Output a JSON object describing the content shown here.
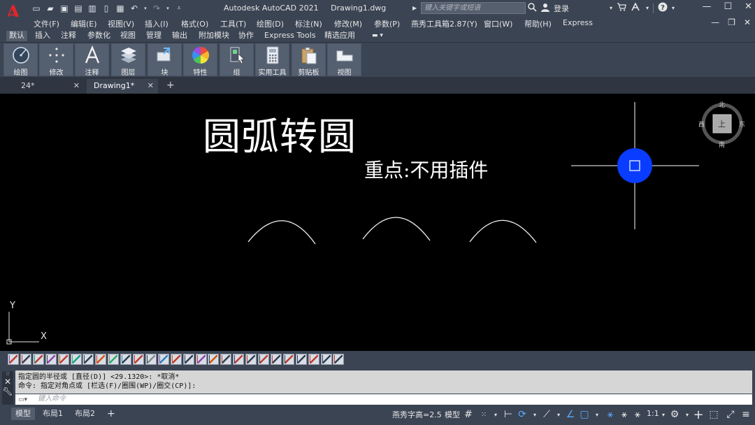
{
  "title_bar": {
    "app_name": "Autodesk AutoCAD 2021",
    "document": "Drawing1.dwg",
    "search_placeholder": "键入关键字或短语",
    "login_label": "登录"
  },
  "menu": [
    "文件(F)",
    "编辑(E)",
    "视图(V)",
    "插入(I)",
    "格式(O)",
    "工具(T)",
    "绘图(D)",
    "标注(N)",
    "修改(M)",
    "参数(P)",
    "燕秀工具箱2.87(Y)",
    "窗口(W)",
    "帮助(H)",
    "Express"
  ],
  "ribbon_tabs": [
    "默认",
    "插入",
    "注释",
    "参数化",
    "视图",
    "管理",
    "输出",
    "附加模块",
    "协作",
    "Express Tools",
    "精选应用"
  ],
  "ribbon_active": "默认",
  "ribbon_buttons": [
    "绘图",
    "修改",
    "注释",
    "图层",
    "块",
    "特性",
    "组",
    "实用工具",
    "剪贴板",
    "视图"
  ],
  "file_tabs": [
    {
      "label": "24*",
      "active": false
    },
    {
      "label": "Drawing1*",
      "active": true
    }
  ],
  "canvas": {
    "title": "圆弧转圆",
    "subtitle": "重点:不用插件",
    "viewcube": {
      "north": "北",
      "south": "南",
      "east": "东",
      "west": "西",
      "face": "上"
    },
    "ucs": {
      "x": "X",
      "y": "Y"
    }
  },
  "command": {
    "history": [
      "指定圆的半径或 [直径(D)] <29.1320>: *取消*",
      "命令: 指定对角点或 [栏选(F)/圈围(WP)/圈交(CP)]:"
    ],
    "input_placeholder": "键入命令"
  },
  "status_bar": {
    "layout_tabs": [
      "模型",
      "布局1",
      "布局2"
    ],
    "text_height": "燕秀字高=2.5",
    "model_label": "模型",
    "scale": "1:1"
  },
  "colors": {
    "chrome": "#3b4453",
    "canvas_bg": "#000000",
    "grip_blue": "#0a3cff",
    "autocad_red": "#e0262a"
  }
}
